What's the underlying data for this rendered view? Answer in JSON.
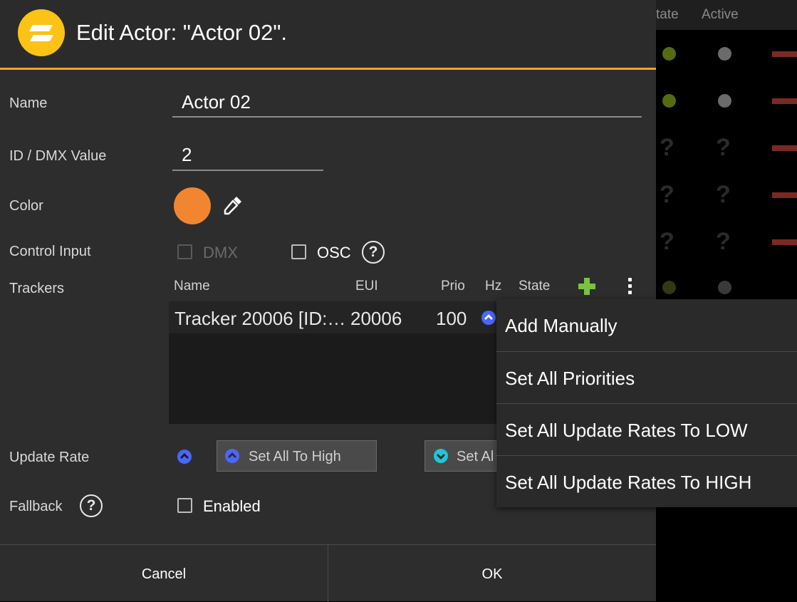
{
  "background_table": {
    "columns": [
      "tate",
      "Active"
    ],
    "row_markers": [
      "?",
      "?",
      "?"
    ]
  },
  "dialog": {
    "title": "Edit Actor: \"Actor 02\".",
    "name": {
      "label": "Name",
      "value": "Actor 02"
    },
    "id": {
      "label": "ID / DMX Value",
      "value": "2"
    },
    "color": {
      "label": "Color",
      "value": "#f28630"
    },
    "control_input": {
      "label": "Control Input",
      "dmx_label": "DMX",
      "osc_label": "OSC",
      "help": "?"
    },
    "trackers": {
      "label": "Trackers",
      "columns": {
        "name": "Name",
        "eui": "EUI",
        "prio": "Prio",
        "hz": "Hz",
        "state": "State"
      },
      "rows": [
        {
          "name": "Tracker 20006 [ID:…",
          "eui": "20006",
          "prio": "100"
        }
      ]
    },
    "update_rate": {
      "label": "Update Rate",
      "set_high": "Set All To High",
      "set_low": "Set Al"
    },
    "fallback": {
      "label": "Fallback",
      "help": "?",
      "enabled_label": "Enabled"
    },
    "footer": {
      "cancel": "Cancel",
      "ok": "OK"
    }
  },
  "menu": {
    "items": [
      {
        "label": "Add Manually"
      },
      {
        "label": "Set All Priorities"
      },
      {
        "label": "Set All Update Rates To LOW"
      },
      {
        "label": "Set All Update Rates To HIGH"
      }
    ]
  },
  "colors": {
    "accent": "#f5a623",
    "logo": "#fcc216",
    "high_rate": "#4a66ff",
    "low_rate": "#20c6d8",
    "add_green": "#7cc242"
  }
}
